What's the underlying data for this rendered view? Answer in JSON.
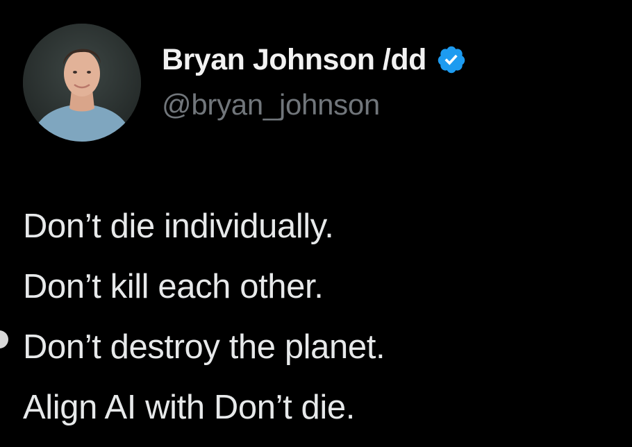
{
  "author": {
    "display_name": "Bryan Johnson /dd",
    "handle": "@bryan_johnson",
    "verified_icon": "verified-badge-icon",
    "avatar_icon": "profile-photo"
  },
  "tweet": {
    "lines": [
      "Don’t die individually.",
      "Don’t kill each other.",
      "Don’t destroy the planet.",
      "Align AI with Don’t die."
    ]
  },
  "colors": {
    "background": "#000000",
    "text_primary": "#e7e9ea",
    "text_secondary": "#71767b",
    "verified_blue": "#1d9bf0"
  }
}
